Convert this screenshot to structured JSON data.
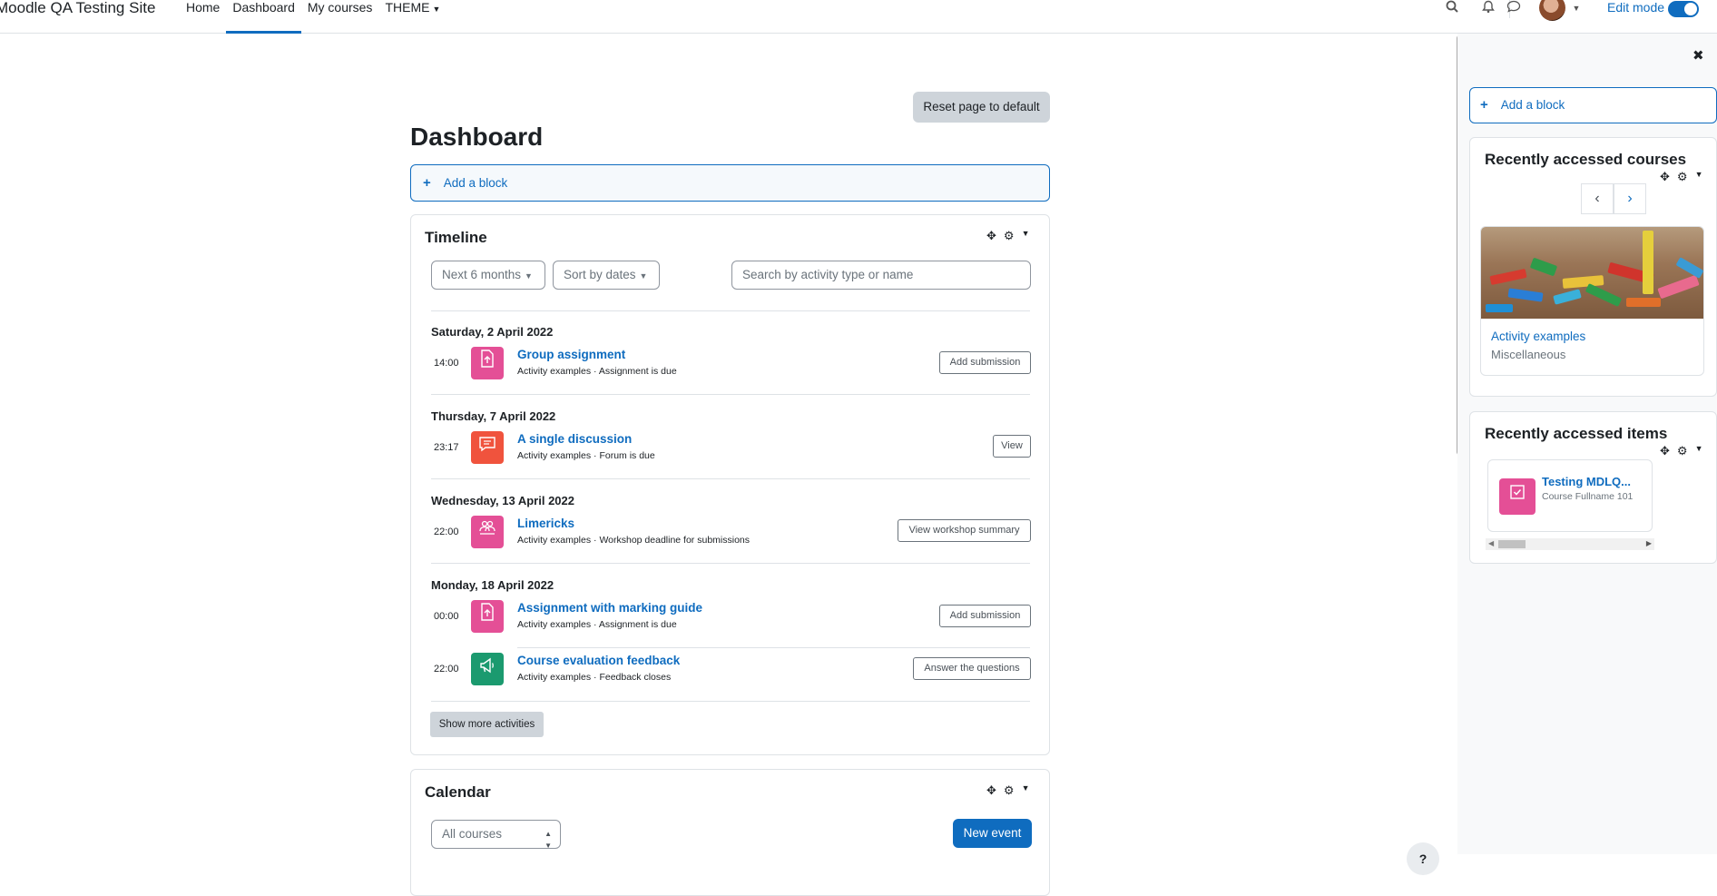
{
  "header": {
    "site_name": "Moodle QA Testing Site",
    "nav": [
      {
        "label": "Home"
      },
      {
        "label": "Dashboard"
      },
      {
        "label": "My courses"
      },
      {
        "label": "THEME"
      }
    ],
    "edit_mode_label": "Edit mode",
    "edit_mode_on": true,
    "icons": [
      "search-icon",
      "bell-icon",
      "chat-icon",
      "avatar",
      "chevron-down-icon"
    ]
  },
  "main": {
    "reset_label": "Reset page to default",
    "title": "Dashboard",
    "add_block_label": "Add a block"
  },
  "timeline": {
    "title": "Timeline",
    "filter_label": "Next 6 months",
    "sort_label": "Sort by dates",
    "search_placeholder": "Search by activity type or name",
    "groups": [
      {
        "date": "Saturday, 2 April 2022",
        "items": [
          {
            "time": "14:00",
            "name": "Group assignment",
            "sub": "Activity examples · Assignment is due",
            "action": "Add submission",
            "icon": "assignment-icon",
            "color": "#e44f96"
          }
        ]
      },
      {
        "date": "Thursday, 7 April 2022",
        "items": [
          {
            "time": "23:17",
            "name": "A single discussion",
            "sub": "Activity examples · Forum is due",
            "action": "View",
            "icon": "forum-icon",
            "color": "#f0533d"
          }
        ]
      },
      {
        "date": "Wednesday, 13 April 2022",
        "items": [
          {
            "time": "22:00",
            "name": "Limericks",
            "sub": "Activity examples · Workshop deadline for submissions",
            "action": "View workshop summary",
            "icon": "workshop-icon",
            "color": "#e44f96"
          }
        ]
      },
      {
        "date": "Monday, 18 April 2022",
        "items": [
          {
            "time": "00:00",
            "name": "Assignment with marking guide",
            "sub": "Activity examples · Assignment is due",
            "action": "Add submission",
            "icon": "assignment-icon",
            "color": "#e44f96"
          },
          {
            "time": "22:00",
            "name": "Course evaluation feedback",
            "sub": "Activity examples · Feedback closes",
            "action": "Answer the questions",
            "icon": "feedback-icon",
            "color": "#1b9a6f"
          }
        ]
      }
    ],
    "show_more_label": "Show more activities"
  },
  "calendar": {
    "title": "Calendar",
    "course_filter": "All courses",
    "new_event_label": "New event"
  },
  "drawer": {
    "add_block_label": "Add a block",
    "recent_courses": {
      "title": "Recently accessed courses",
      "course_name": "Activity examples",
      "course_category": "Miscellaneous"
    },
    "recent_items": {
      "title": "Recently accessed items",
      "item_name": "Testing MDLQ...",
      "item_course": "Course Fullname 101"
    }
  }
}
